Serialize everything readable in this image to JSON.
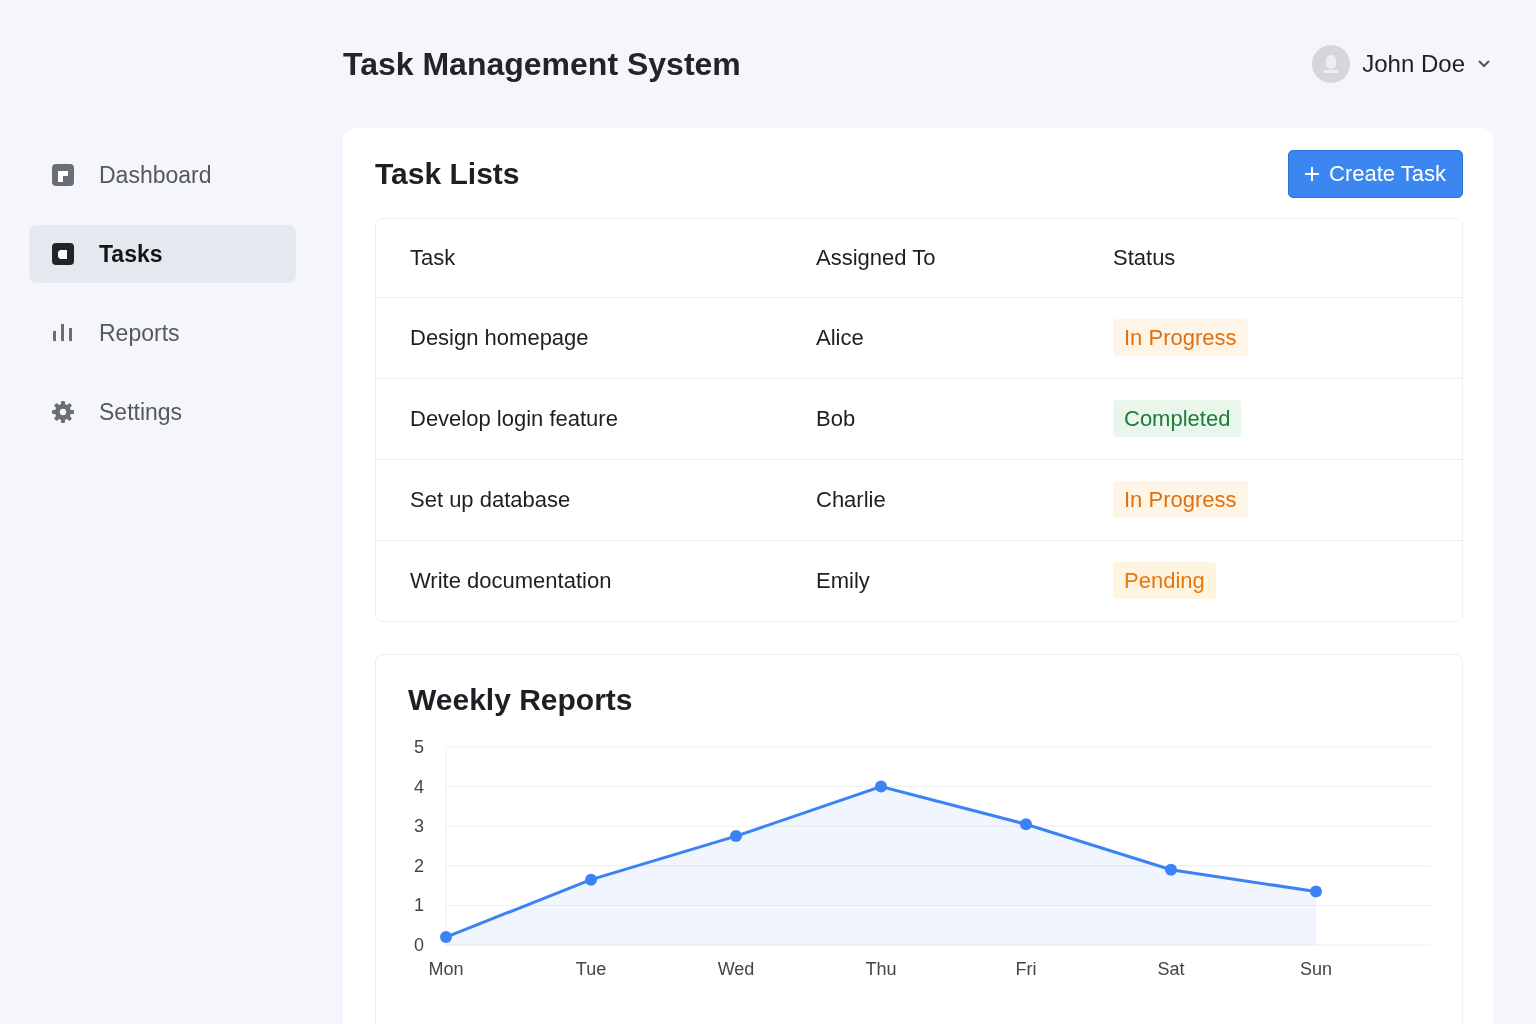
{
  "sidebar": {
    "items": [
      {
        "label": "Dashboard",
        "selected": false
      },
      {
        "label": "Tasks",
        "selected": true
      },
      {
        "label": "Reports",
        "selected": false
      },
      {
        "label": "Settings",
        "selected": false
      }
    ]
  },
  "header": {
    "title": "Task Management System",
    "user": "John Doe"
  },
  "task_card": {
    "title": "Task Lists",
    "create_button": "Create Task",
    "table": {
      "columns": [
        "Task",
        "Assigned To",
        "Status"
      ],
      "rows": [
        {
          "task": "Design homepage",
          "assignee": "Alice",
          "status": "In Progress",
          "kind": "in_progress"
        },
        {
          "task": "Develop login feature",
          "assignee": "Bob",
          "status": "Completed",
          "kind": "completed"
        },
        {
          "task": "Set up database",
          "assignee": "Charlie",
          "status": "In Progress",
          "kind": "in_progress"
        },
        {
          "task": "Write documentation",
          "assignee": "Emily",
          "status": "Pending",
          "kind": "pending"
        }
      ]
    }
  },
  "reports": {
    "title": "Weekly Reports",
    "chart_data": {
      "type": "area",
      "grid": true,
      "categories": [
        "Mon",
        "Tue",
        "Wed",
        "Thu",
        "Fri",
        "Sat",
        "Sun"
      ],
      "ylim": [
        0,
        5
      ],
      "yticks": [
        0,
        1,
        2,
        3,
        4,
        5
      ],
      "series": [
        {
          "color": "#3b82f6",
          "marker": "circle",
          "values": [
            0.2,
            1.65,
            2.75,
            4.0,
            3.05,
            1.9,
            1.35
          ]
        }
      ]
    }
  }
}
